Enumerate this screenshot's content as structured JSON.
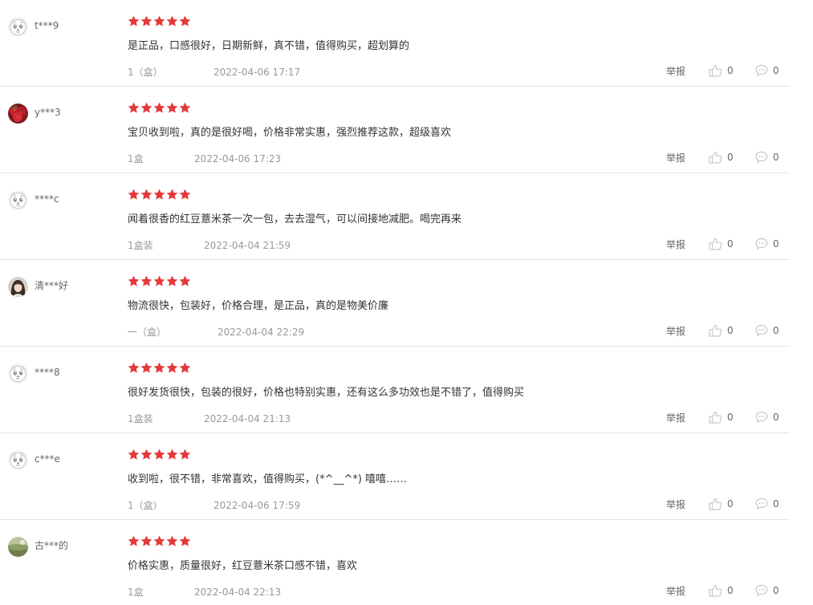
{
  "colors": {
    "star": "#e4393c",
    "icon_gray": "#c8c8c8",
    "divider": "#e5e5e5"
  },
  "labels": {
    "report": "举报"
  },
  "reviews": [
    {
      "user": "t***9",
      "avatar": "default-avatar",
      "rating": 5,
      "content": "是正品，口感很好，日期新鲜，真不错，值得购买，超划算的",
      "spec": "1（盒）",
      "date": "2022-04-06 17:17",
      "likes": "0",
      "replies": "0"
    },
    {
      "user": "y***3",
      "avatar": "strawberry-photo-avatar",
      "rating": 5,
      "content": "宝贝收到啦，真的是很好喝，价格非常实惠，强烈推荐这款，超级喜欢",
      "spec": "1盒",
      "date": "2022-04-06 17:23",
      "likes": "0",
      "replies": "0"
    },
    {
      "user": "****c",
      "avatar": "default-avatar",
      "rating": 5,
      "content": "闻着很香的红豆薏米茶一次一包，去去湿气，可以间接地减肥。喝完再来",
      "spec": "1盒装",
      "date": "2022-04-04 21:59",
      "likes": "0",
      "replies": "0"
    },
    {
      "user": "清***好",
      "avatar": "girl-photo-avatar",
      "rating": 5,
      "content": "物流很快，包装好，价格合理，是正品，真的是物美价廉",
      "spec": "一（盒）",
      "date": "2022-04-04 22:29",
      "likes": "0",
      "replies": "0"
    },
    {
      "user": "****8",
      "avatar": "default-avatar",
      "rating": 5,
      "content": "很好发货很快，包装的很好，价格也特别实惠，还有这么多功效也是不错了，值得购买",
      "spec": "1盒装",
      "date": "2022-04-04 21:13",
      "likes": "0",
      "replies": "0"
    },
    {
      "user": "c***e",
      "avatar": "default-avatar",
      "rating": 5,
      "content": "收到啦，很不错，非常喜欢，值得购买，(*^__^*) 嘻嘻……",
      "spec": "1（盒）",
      "date": "2022-04-06 17:59",
      "likes": "0",
      "replies": "0"
    },
    {
      "user": "古***的",
      "avatar": "landscape-photo-avatar",
      "rating": 5,
      "content": "价格实惠，质量很好，红豆薏米茶口感不错，喜欢",
      "spec": "1盒",
      "date": "2022-04-04 22:13",
      "likes": "0",
      "replies": "0"
    }
  ]
}
